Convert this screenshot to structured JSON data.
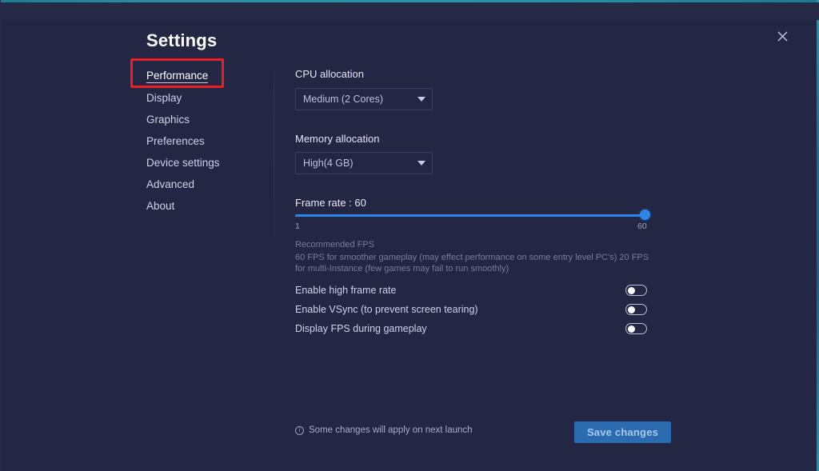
{
  "window": {
    "title": "Settings",
    "close_icon": "close-icon",
    "accent_edge_color": "#2596a8",
    "background_color": "#232744"
  },
  "annotation": {
    "color": "#ee1d20",
    "target": "Performance"
  },
  "sidebar": {
    "items": [
      {
        "label": "Performance",
        "active": true
      },
      {
        "label": "Display",
        "active": false
      },
      {
        "label": "Graphics",
        "active": false
      },
      {
        "label": "Preferences",
        "active": false
      },
      {
        "label": "Device settings",
        "active": false
      },
      {
        "label": "Advanced",
        "active": false
      },
      {
        "label": "About",
        "active": false
      }
    ]
  },
  "main": {
    "cpu": {
      "label": "CPU allocation",
      "value": "Medium (2 Cores)",
      "caret_icon": "chevron-down-icon"
    },
    "memory": {
      "label": "Memory allocation",
      "value": "High(4 GB)",
      "caret_icon": "chevron-down-icon"
    },
    "frame_rate": {
      "label": "Frame rate : 60",
      "value": 60,
      "min": 1,
      "max": 60,
      "min_label": "1",
      "max_label": "60",
      "fill_percent": 100,
      "accent_color": "#2d86ec"
    },
    "recommended": {
      "title": "Recommended FPS",
      "description": "60 FPS for smoother gameplay (may effect performance on some entry level PC's) 20 FPS for multi-Instance (few games may fail to run smoothly)"
    },
    "toggles": [
      {
        "label": "Enable high frame rate",
        "on": false
      },
      {
        "label": "Enable VSync (to prevent screen tearing)",
        "on": false
      },
      {
        "label": "Display FPS during gameplay",
        "on": false
      }
    ]
  },
  "footer": {
    "info_icon": "info-icon",
    "note": "Some changes will apply on next launch",
    "save_label": "Save changes",
    "save_color": "#2b6bb0"
  }
}
